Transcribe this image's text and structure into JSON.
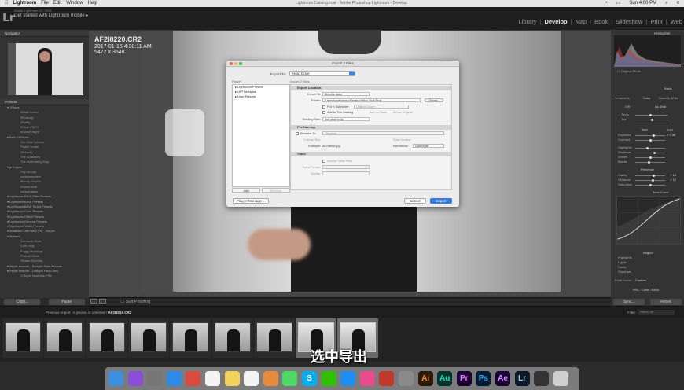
{
  "menubar": {
    "app": "Lightroom",
    "items": [
      "File",
      "Edit",
      "Window",
      "Help"
    ],
    "window_title": "Lightroom Catalog.lrcat - Adobe Photoshop Lightroom - Develop",
    "clock": "Sun 4:00 PM"
  },
  "topbar": {
    "logo": "Lr",
    "adobe_line": "Adobe Lightroom CC 2015",
    "mobile_text": "Get started with Lightroom mobile ▸",
    "modules": [
      "Library",
      "Develop",
      "Map",
      "Book",
      "Slideshow",
      "Print",
      "Web"
    ],
    "active_module": "Develop"
  },
  "left_panel": {
    "navigator_label": "Navigator",
    "presets_label": "Presets",
    "presets": [
      {
        "type": "folder",
        "label": "1Stops"
      },
      {
        "type": "item",
        "label": "2Bold Green"
      },
      {
        "type": "item",
        "label": "3Everday"
      },
      {
        "type": "item",
        "label": "4Softly"
      },
      {
        "type": "item",
        "label": "5Vivid VSCO"
      },
      {
        "type": "item",
        "label": "6Sunkit Night"
      },
      {
        "type": "folder",
        "label": "Bew VSIItems"
      },
      {
        "type": "item",
        "label": "Vin Gold Colours"
      },
      {
        "type": "item",
        "label": "Faded Tones"
      },
      {
        "type": "item",
        "label": "Of Earth"
      },
      {
        "type": "item",
        "label": "The Grassium"
      },
      {
        "type": "item",
        "label": "The Underming Day"
      },
      {
        "type": "folder",
        "label": "jrrSnipes"
      },
      {
        "type": "item",
        "label": "City Moody"
      },
      {
        "type": "item",
        "label": "cookiemonster"
      },
      {
        "type": "item",
        "label": "Moody Greens"
      },
      {
        "type": "item",
        "label": "Sunset shift"
      },
      {
        "type": "item",
        "label": "rubeamaken"
      },
      {
        "type": "folder",
        "label": "Lightroom B&W Filter Presets"
      },
      {
        "type": "folder",
        "label": "Lightroom B&W Presets"
      },
      {
        "type": "folder",
        "label": "Lightroom B&W Toned Presets"
      },
      {
        "type": "folder",
        "label": "Lightroom Color Presets"
      },
      {
        "type": "folder",
        "label": "Lightroom Effect Presets"
      },
      {
        "type": "folder",
        "label": "Lightroom General Presets"
      },
      {
        "type": "folder",
        "label": "Lightroom Video Presets"
      },
      {
        "type": "folder",
        "label": "Madeline Lefs RaW Pro - Garpix"
      },
      {
        "type": "folder",
        "label": "Matrum"
      },
      {
        "type": "item",
        "label": "Constant Glow"
      },
      {
        "type": "item",
        "label": "Cool King"
      },
      {
        "type": "item",
        "label": "Foggy Mornings"
      },
      {
        "type": "item",
        "label": "Portrait Vibes"
      },
      {
        "type": "item",
        "label": "Vibrant Scenery"
      },
      {
        "type": "folder",
        "label": "Reple Ananne - Sample Pack Presets"
      },
      {
        "type": "folder",
        "label": "Reple Ananne - Lastype Pack Only"
      },
      {
        "type": "item",
        "label": "1 Reple Nashville Film"
      }
    ],
    "copy_btn": "Copy...",
    "paste_btn": "Paste"
  },
  "photo_info": {
    "filename": "AF2I8220.CR2",
    "datetime": "2017-01-15 4:30:11 AM",
    "dimensions": "5472 x 3648"
  },
  "toolbar": {
    "soft_proofing": "Soft Proofing"
  },
  "dialog": {
    "title": "Export 2 Files",
    "export_to_label": "Export To:",
    "export_to_value": "Hard Drive",
    "preset_label": "Preset:",
    "export_files_label": "Export 2 Files",
    "presets": [
      "▸ Lightroom Presets",
      "▸ UPTimelapse",
      "▸ User Presets"
    ],
    "add_btn": "Add",
    "remove_btn": "Remove",
    "sections": {
      "export_location": {
        "header": "Export Location",
        "export_to_label": "Export To:",
        "export_to_value": "Specific folder",
        "folder_label": "Folder:",
        "folder_value": "/Users/jonathanmar/Desktop/Milan Stuff Final",
        "choose_btn": "Choose...",
        "put_in_subfolder": "Put in Subfolder:",
        "subfolder_value": "Untitled Export",
        "add_to_catalog": "Add to This Catalog",
        "add_to_stack": "Add to Stack:",
        "below_original": "Below Original",
        "existing_files_label": "Existing Files:",
        "existing_files_value": "Ask what to do"
      },
      "file_naming": {
        "header": "File Naming",
        "rename_to_label": "Rename To:",
        "rename_to_value": "Filename",
        "custom_text_label": "Custom Text:",
        "start_number_label": "Start Number:",
        "example_label": "Example:",
        "example_value": "AF2I8858.jpg",
        "extensions_label": "Extensions:",
        "extensions_value": "Lowercase"
      },
      "video": {
        "header": "Video",
        "include_video": "Include Video Files",
        "video_format_label": "Video Format:",
        "quality_label": "Quality:"
      }
    },
    "plugin_btn": "Plug-in Manager...",
    "cancel_btn": "Cancel",
    "export_btn": "Export"
  },
  "right_panel": {
    "histogram_label": "Histogram",
    "original_photo": "Original Photo",
    "basic_label": "Basic",
    "treatment_label": "Treatment:",
    "treatment_color": "Color",
    "treatment_bw": "Black & White",
    "wb_label": "WB :",
    "wb_value": "As Shot",
    "sliders_group1": [
      "Temp",
      "Tint"
    ],
    "tone_label": "Tone",
    "tone_value": "Auto",
    "sliders_group2": [
      "Exposure",
      "Contrast"
    ],
    "sliders_group3": [
      "Highlights",
      "Shadows",
      "Whites",
      "Blacks"
    ],
    "presence_label": "Presence",
    "sliders_group4": [
      "Clarity",
      "Vibrance",
      "Saturation"
    ],
    "temp_value": "",
    "exposure_value": "+ 0.35",
    "clarity_value": "+ 14",
    "vibrance_value": "+ 12",
    "tone_curve_label": "Tone Curve",
    "region_label": "Region",
    "region_items": [
      "Highlights",
      "Lights",
      "Darks",
      "Shadows"
    ],
    "point_curve_label": "Point Curve :",
    "point_curve_value": "Custom",
    "hsl_label": "HSL / Color / B&W",
    "sync_btn": "Sync...",
    "reset_btn": "Reset"
  },
  "filmstrip": {
    "prev_import": "Previous Import",
    "info_prefix": "6 photos /2 selected /",
    "selected_file": "AF2I8219.CR2",
    "filter_label": "Filter :",
    "filter_value": "Filters Off",
    "thumb_count": 9,
    "selected_thumbs": [
      7,
      8
    ]
  },
  "subtitle": "选中导出",
  "dock": {
    "icons": [
      "finder-icon",
      "siri-icon",
      "launchpad-icon",
      "safari-icon",
      "chrome-icon",
      "calendar-icon",
      "notes-icon",
      "reminders-icon",
      "photos-icon",
      "messages-icon",
      "skype-icon",
      "wechat-icon",
      "app-store-icon",
      "itunes-icon",
      "photo-booth-icon",
      "system-preferences-icon",
      "illustrator-icon",
      "audition-icon",
      "premiere-icon",
      "photoshop-icon",
      "after-effects-icon",
      "lightroom-icon",
      "activity-icon",
      "trash-icon"
    ],
    "labels": {
      "illustrator": "Ai",
      "audition": "Au",
      "premiere": "Pr",
      "photoshop": "Ps",
      "after_effects": "Ae",
      "lightroom": "Lr",
      "skype": "S"
    }
  },
  "colors": {
    "accent_blue": "#2f7ae5",
    "panel": "#333333",
    "dialog_bg": "#ececec"
  }
}
